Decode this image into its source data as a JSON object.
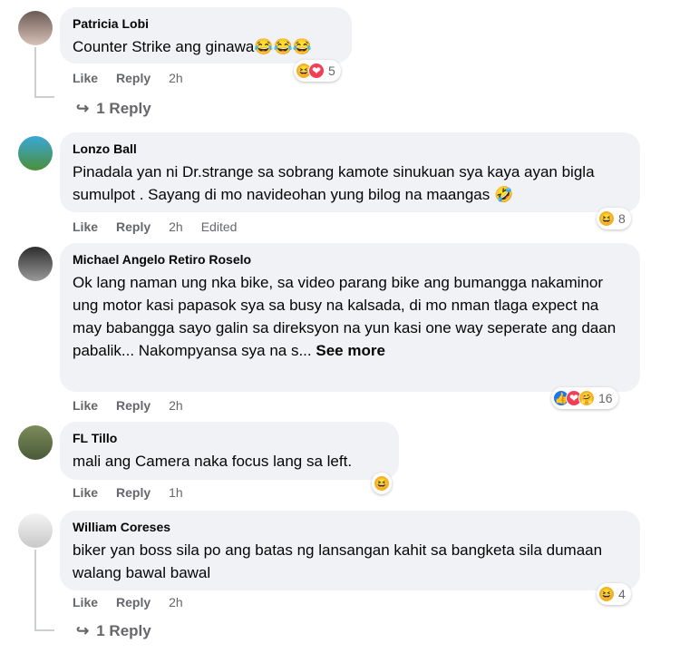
{
  "comments": [
    {
      "author": "Patricia Lobi",
      "text": "Counter Strike ang ginawa😂😂😂",
      "like_label": "Like",
      "reply_label": "Reply",
      "time": "2h",
      "reaction_count": "5",
      "replies_link": "1 Reply"
    },
    {
      "author": "Lonzo Ball",
      "text": "Pinadala yan ni Dr.strange sa sobrang kamote sinukuan sya kaya ayan bigla sumulpot . Sayang di mo navideohan yung bilog na maangas 🤣",
      "like_label": "Like",
      "reply_label": "Reply",
      "time": "2h",
      "edited": "Edited",
      "reaction_count": "8"
    },
    {
      "author": "Michael Angelo Retiro Roselo",
      "text": "Ok lang naman ung nka bike, sa video parang bike ang bumangga nakaminor ung motor kasi papasok sya sa busy na kalsada, di mo nman tlaga expect na may babangga sayo galin sa direksyon na yun kasi one way seperate ang daan pabalik... Nakompyansa sya na s...",
      "see_more": "See more",
      "like_label": "Like",
      "reply_label": "Reply",
      "time": "2h",
      "reaction_count": "16"
    },
    {
      "author": "FL Tillo",
      "text": "mali ang Camera naka focus lang sa left.",
      "like_label": "Like",
      "reply_label": "Reply",
      "time": "1h"
    },
    {
      "author": "William Coreses",
      "text": "biker yan boss sila po ang batas ng lansangan kahit sa bangketa sila dumaan walang bawal bawal",
      "like_label": "Like",
      "reply_label": "Reply",
      "time": "2h",
      "reaction_count": "4",
      "replies_link": "1 Reply"
    }
  ],
  "icons": {
    "haha": "😆",
    "love": "❤",
    "like": "👍",
    "care": "🤗",
    "reply_arrow": "↪"
  }
}
